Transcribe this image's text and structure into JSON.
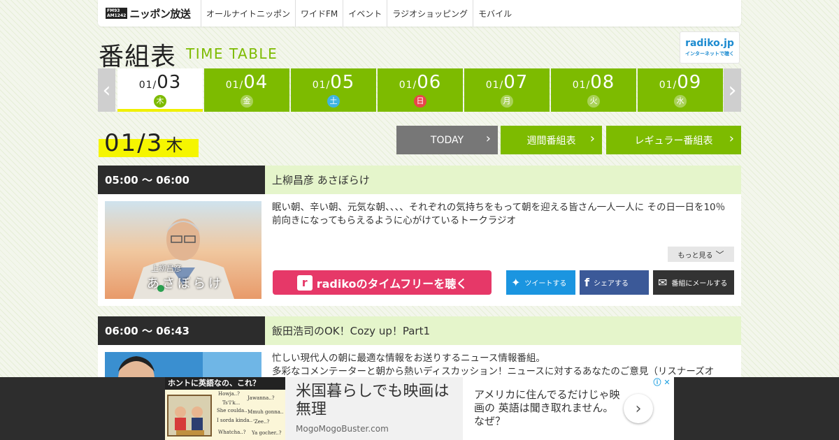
{
  "nav": {
    "logo_freq_top": "FM93",
    "logo_freq_bottom": "AM1242",
    "logo_text": "ニッポン放送",
    "items": [
      "オールナイトニッポン",
      "ワイドFM",
      "イベント",
      "ラジオショッピング",
      "モバイル"
    ]
  },
  "header": {
    "title": "番組表",
    "subtitle": "TIME TABLE",
    "radiko_logo": "radiko.jp",
    "radiko_sub": "インターネットで聴く"
  },
  "dates": [
    {
      "prefix": "01/",
      "day": "03",
      "dow": "木",
      "type": "weekday",
      "active": true
    },
    {
      "prefix": "01/",
      "day": "04",
      "dow": "金",
      "type": "weekday",
      "active": false
    },
    {
      "prefix": "01/",
      "day": "05",
      "dow": "土",
      "type": "sat",
      "active": false
    },
    {
      "prefix": "01/",
      "day": "06",
      "dow": "日",
      "type": "sun",
      "active": false
    },
    {
      "prefix": "01/",
      "day": "07",
      "dow": "月",
      "type": "weekday",
      "active": false
    },
    {
      "prefix": "01/",
      "day": "08",
      "dow": "火",
      "type": "weekday",
      "active": false
    },
    {
      "prefix": "01/",
      "day": "09",
      "dow": "水",
      "type": "weekday",
      "active": false
    }
  ],
  "current_date": {
    "date": "01/3",
    "dow": "木"
  },
  "actions": {
    "today": "TODAY",
    "weekly": "週間番組表",
    "regular": "レギュラー番組表"
  },
  "colors": {
    "accent_green": "#7dbb00",
    "highlight_yellow": "#f5f500",
    "radiko_pink": "#e63868",
    "twitter": "#1b95e0",
    "facebook": "#3b5998",
    "mail": "#333333"
  },
  "programs": [
    {
      "time": "05:00 ～ 06:00",
      "title": "上柳昌彦 あさぼらけ",
      "desc": "眠い朝、辛い朝、元気な朝、、、、それぞれの気持ちをもって朝を迎える皆さん一人一人に その日一日を10％前向きになってもらえるように心がけているトークラジオ",
      "img_caption_small": "上柳昌彦",
      "img_caption_big": "あさぼらけ",
      "more": "もっと見る",
      "radiko_label": "radikoのタイムフリーを聴く",
      "tweet": "ツイートする",
      "share": "シェアする",
      "mail": "番組にメールする"
    },
    {
      "time": "06:00 ～ 06:43",
      "title": "飯田浩司のOK！Cozy up！Part1",
      "desc": "忙しい現代人の朝に最適な情報をお送りするニュース情報番組。\n多彩なコメンテーターと朝から熱いディスカッション！ニュースに対するあなたのご意見（リスナーズオ"
    }
  ],
  "ad": {
    "image_title": "ホントに英語なの、これ？",
    "image_bubbles": [
      "Howja..?",
      "Jawanna..?",
      "Ts'I'k...",
      "She coulda..",
      "Mmuh gonna..",
      "I sorda kinda..",
      "'Zee..?",
      "Whatcha..?",
      "Ya gocher..?"
    ],
    "headline": "米国暮らしでも映画は無理",
    "domain": "MogoMogoBuster.com",
    "text": "アメリカに住んでるだけじゃ映画の 英語は聞き取れません。なぜ？",
    "next_icon": "chevron-right-icon"
  }
}
